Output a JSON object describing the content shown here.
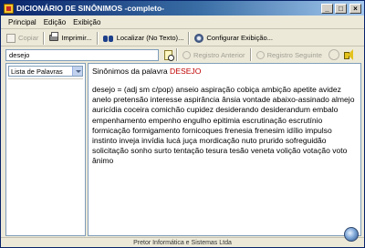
{
  "window": {
    "title": "DICIONÁRIO DE SINÔNIMOS -completo-",
    "buttons": {
      "minimize": "_",
      "maximize": "□",
      "close": "×"
    }
  },
  "menu": {
    "items": [
      {
        "label": "Principal"
      },
      {
        "label": "Edição"
      },
      {
        "label": "Exibição"
      }
    ]
  },
  "toolbar": {
    "copy": {
      "label": "Copiar",
      "icon": "copy-icon",
      "enabled": false
    },
    "print": {
      "label": "Imprimir...",
      "icon": "printer-icon",
      "enabled": true
    },
    "find": {
      "label": "Localizar (No Texto)...",
      "icon": "binoculars-icon",
      "enabled": true
    },
    "configure": {
      "label": "Configurar Exibição...",
      "icon": "gear-icon",
      "enabled": true
    }
  },
  "search": {
    "value": "desejo",
    "prev_label": "Registro Anterior",
    "next_label": "Registro Seguinte"
  },
  "left": {
    "select_value": "Lista de Palavras"
  },
  "content": {
    "heading_prefix": "Sinônimos da palavra ",
    "heading_word": "DESEJO",
    "definition": "desejo = (adj sm c/pop) anseio aspiração cobiça ambição apetite avidez anelo pretensão interesse aspirância ânsia vontade abaixo-assinado almejo auricídia coceira comichão cupidez desiderando desiderandum embalo empenhamento empenho engulho epitimia escrutinação escrutínio formicação formigamento fornicoques frenesia frenesim idílio impulso instinto inveja invídia lucá juça mordicação nuto prurido sofreguidão solicitação sonho surto tentação tesura tesão veneta volição votação voto ânimo"
  },
  "status": {
    "text": "Pretor Informática e Sistemas Ltda"
  },
  "colors": {
    "titlebar_start": "#0a246a",
    "highlight_word": "#c00000",
    "window_bg": "#ece9d8"
  }
}
